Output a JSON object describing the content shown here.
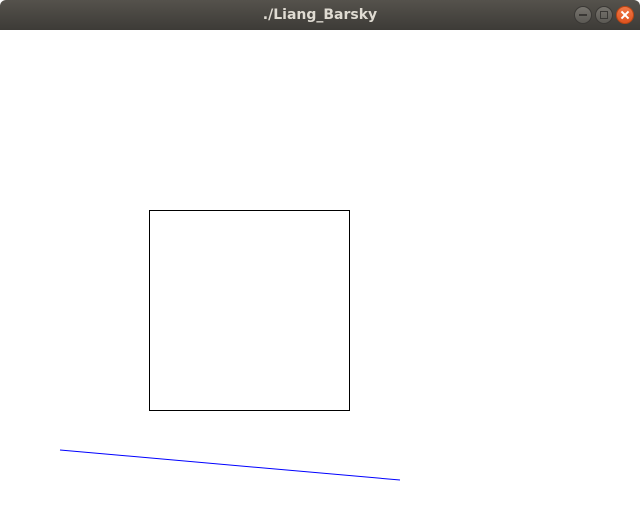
{
  "window": {
    "title": "./Liang_Barsky"
  },
  "controls": {
    "minimize_icon": "minimize-icon",
    "maximize_icon": "maximize-icon",
    "close_icon": "close-icon"
  },
  "colors": {
    "clip_window_stroke": "#000000",
    "line_stroke": "#0000ff"
  }
}
